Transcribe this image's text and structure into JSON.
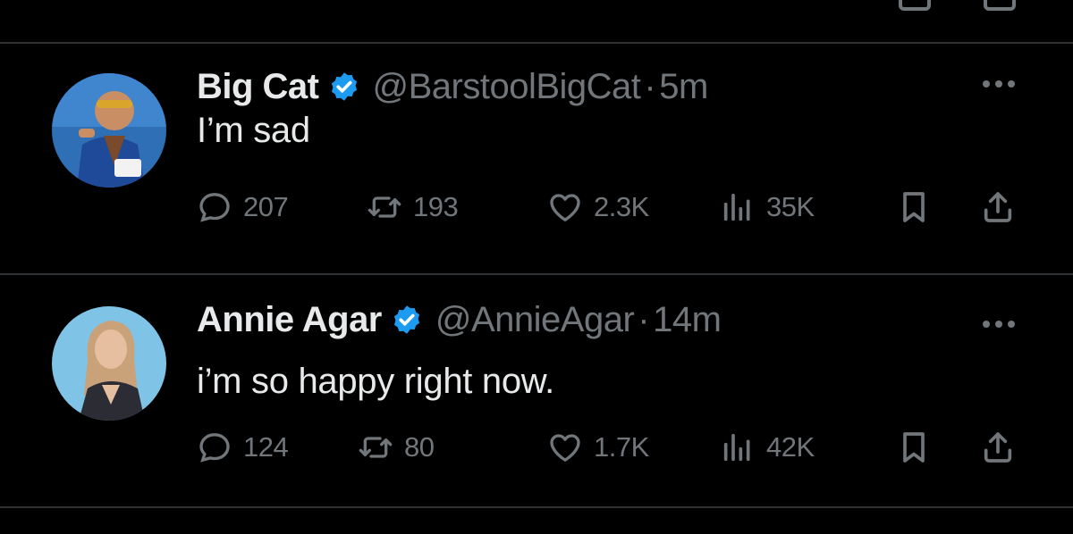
{
  "tweets": [
    {
      "name": "Big Cat",
      "handle": "@BarstoolBigCat",
      "separator": "·",
      "time": "5m",
      "text": "I’m sad",
      "replies": "207",
      "reposts": "193",
      "likes": "2.3K",
      "views": "35K"
    },
    {
      "name": "Annie Agar",
      "handle": "@AnnieAgar",
      "separator": "·",
      "time": "14m",
      "text": "i’m so happy right now.",
      "replies": "124",
      "reposts": "80",
      "likes": "1.7K",
      "views": "42K"
    }
  ],
  "colors": {
    "background": "#000000",
    "primary_text": "#e7e9ea",
    "secondary_text": "#71767b",
    "verified_badge": "#1d9bf0",
    "divider": "#2f3336"
  },
  "icons": [
    "verified-badge-icon",
    "more-icon",
    "reply-icon",
    "repost-icon",
    "like-icon",
    "views-icon",
    "bookmark-icon",
    "share-icon"
  ]
}
